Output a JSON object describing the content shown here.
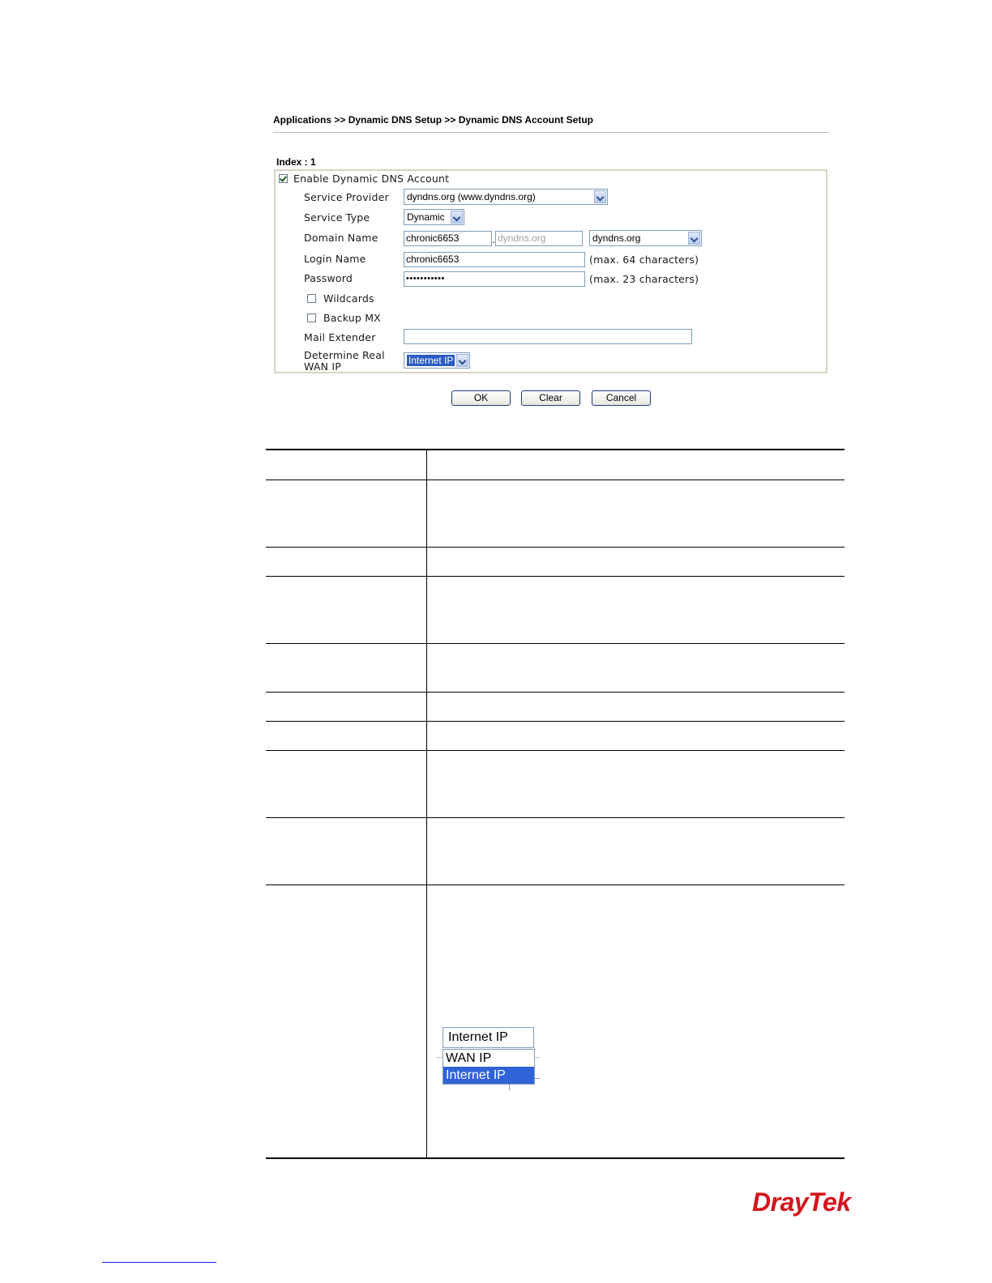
{
  "breadcrumb": "Applications >> Dynamic DNS Setup >> Dynamic DNS Account Setup",
  "index_label": "Index : 1",
  "form": {
    "enable": {
      "label": "Enable Dynamic DNS Account",
      "checked": true
    },
    "service_provider": {
      "label": "Service Provider",
      "value": "dyndns.org (www.dyndns.org)"
    },
    "service_type": {
      "label": "Service Type",
      "value": "Dynamic"
    },
    "domain_name": {
      "label": "Domain Name",
      "host_value": "chronic6653",
      "separator": ".",
      "suffix_placeholder": "dyndns.org",
      "suffix_select": "dyndns.org"
    },
    "login_name": {
      "label": "Login Name",
      "value": "chronic6653",
      "hint": "(max. 64 characters)"
    },
    "password": {
      "label": "Password",
      "value": "•••••••••••",
      "hint": "(max. 23 characters)"
    },
    "wildcards": {
      "label": "Wildcards",
      "checked": false
    },
    "backup_mx": {
      "label": "Backup MX",
      "checked": false
    },
    "mail_extender": {
      "label": "Mail Extender",
      "value": ""
    },
    "determine_wan_ip": {
      "label_line1": "Determine Real",
      "label_line2": "WAN IP",
      "value": "Internet IP"
    }
  },
  "buttons": {
    "ok": "OK",
    "clear": "Clear",
    "cancel": "Cancel"
  },
  "dropdown_example": {
    "selected": "Internet IP",
    "options": [
      "WAN IP",
      "Internet IP"
    ],
    "highlighted": "Internet IP"
  },
  "logo": "DrayTek",
  "colors": {
    "logo": "#d4141c",
    "selection": "#2a5bc4",
    "input_border": "#7f9db9"
  }
}
